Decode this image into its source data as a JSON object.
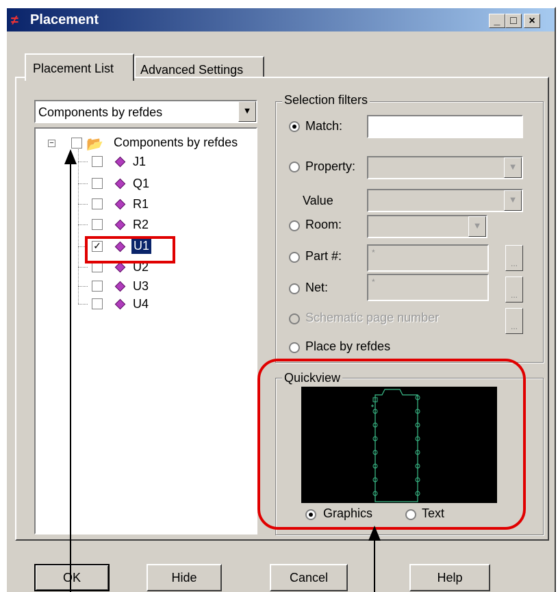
{
  "window": {
    "title": "Placement",
    "controls": {
      "minimize": "_",
      "maximize": "□",
      "close": "×"
    }
  },
  "tabs": [
    {
      "label": "Placement List",
      "active": true
    },
    {
      "label": "Advanced Settings",
      "active": false
    }
  ],
  "left": {
    "dropdown_value": "Components by refdes",
    "tree": {
      "root_label": "Components by refdes",
      "items": [
        {
          "label": "J1",
          "checked": false
        },
        {
          "label": "Q1",
          "checked": false
        },
        {
          "label": "R1",
          "checked": false
        },
        {
          "label": "R2",
          "checked": false
        },
        {
          "label": "U1",
          "checked": true,
          "selected": true
        },
        {
          "label": "U2",
          "checked": false
        },
        {
          "label": "U3",
          "checked": false
        },
        {
          "label": "U4",
          "checked": false
        }
      ]
    }
  },
  "filters": {
    "group_label": "Selection filters",
    "match_label": "Match:",
    "match_value": "",
    "property_label": "Property:",
    "value_label": "Value",
    "room_label": "Room:",
    "part_label": "Part #:",
    "part_value": "*",
    "net_label": "Net:",
    "net_value": "*",
    "schematic_label": "Schematic page number",
    "refdes_label": "Place by refdes",
    "ellipsis": "..."
  },
  "quickview": {
    "group_label": "Quickview",
    "graphics_label": "Graphics",
    "text_label": "Text",
    "selected": "Graphics"
  },
  "buttons": {
    "ok": "OK",
    "hide": "Hide",
    "cancel": "Cancel",
    "help": "Help"
  },
  "colors": {
    "highlight": "#e00000",
    "titlebar": "#0a246a",
    "preview_bg": "#000000",
    "symbol": "#3cc08c"
  }
}
